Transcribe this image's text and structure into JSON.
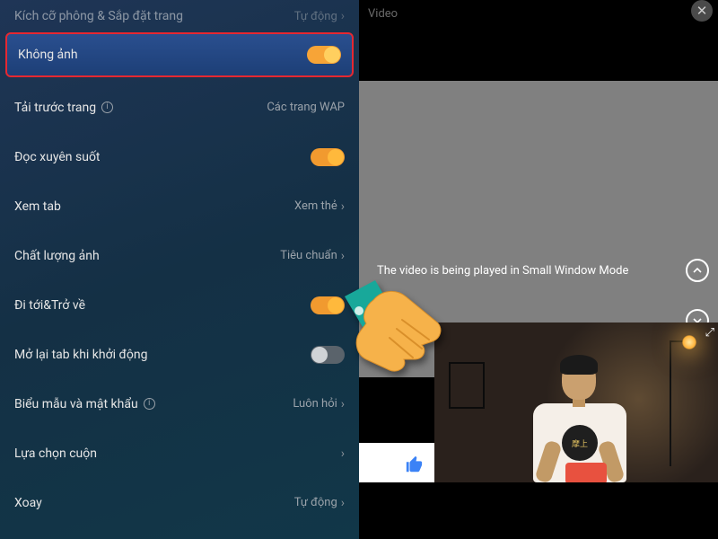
{
  "left": {
    "top_row": {
      "label": "Kích cỡ phông & Sắp đặt trang",
      "value": "Tự động"
    },
    "rows": [
      {
        "key": "no_image",
        "label": "Không ảnh",
        "type": "toggle",
        "on": true,
        "highlight": true
      },
      {
        "key": "preload",
        "label": "Tải trước trang",
        "type": "value",
        "value": "Các trang WAP",
        "info": true
      },
      {
        "key": "readthru",
        "label": "Đọc xuyên suốt",
        "type": "toggle",
        "on": true
      },
      {
        "key": "tabview",
        "label": "Xem tab",
        "type": "value",
        "value": "Xem thẻ",
        "chev": true
      },
      {
        "key": "imgqual",
        "label": "Chất lượng ảnh",
        "type": "value",
        "value": "Tiêu chuẩn",
        "chev": true
      },
      {
        "key": "goback",
        "label": "Đi tới&Trở về",
        "type": "toggle",
        "on": true
      },
      {
        "key": "reopen",
        "label": "Mở lại tab khi khởi động",
        "type": "toggle",
        "on": false
      },
      {
        "key": "forms",
        "label": "Biểu mẫu và mật khẩu",
        "type": "value",
        "value": "Luôn hỏi",
        "info": true,
        "chev": true
      },
      {
        "key": "scroll",
        "label": "Lựa chọn cuộn",
        "type": "value",
        "value": "",
        "chev": true
      },
      {
        "key": "rotate",
        "label": "Xoay",
        "type": "value",
        "value": "Tự động",
        "chev": true
      }
    ]
  },
  "right": {
    "header_title": "Video",
    "message": "The video is being played in Small Window Mode",
    "icons": {
      "close": "close-icon",
      "up": "chevron-up-icon",
      "down": "chevron-down-icon",
      "expand": "expand-icon",
      "like": "thumbs-up-icon"
    }
  }
}
